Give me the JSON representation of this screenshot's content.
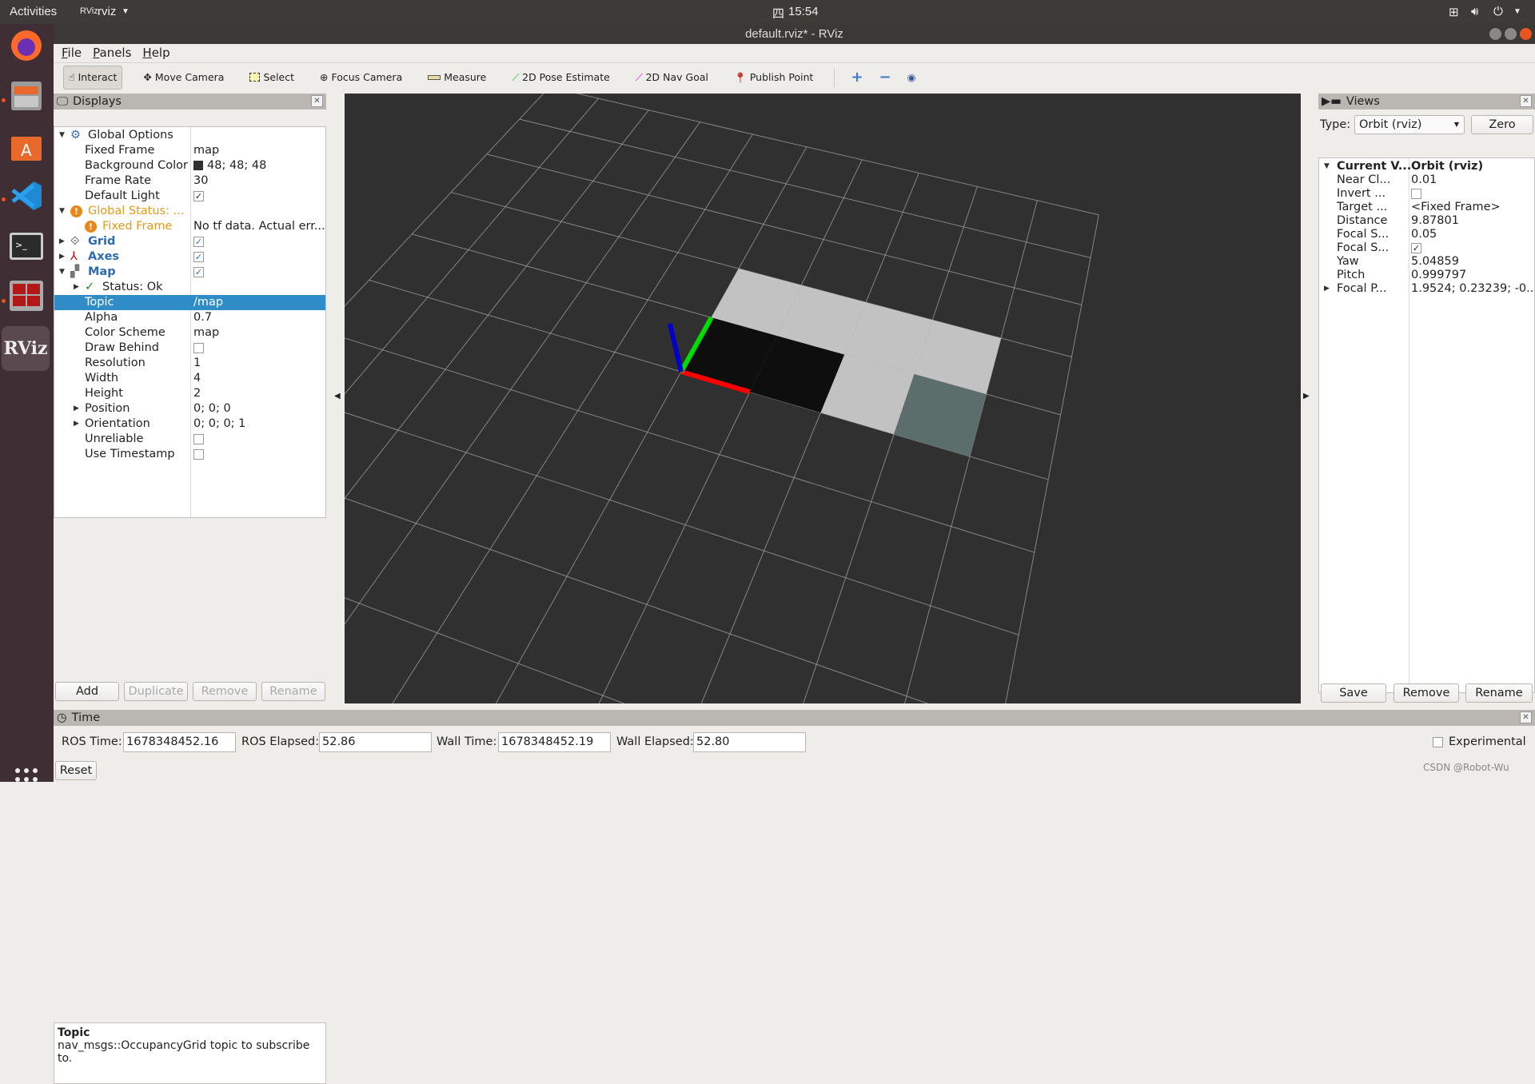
{
  "topbar": {
    "activities": "Activities",
    "app": "rviz",
    "clock": "15:54",
    "clock_glyph": "四"
  },
  "window": {
    "title": "default.rviz* - RViz"
  },
  "menu": [
    "File",
    "Panels",
    "Help"
  ],
  "toolbar": [
    {
      "label": "Interact",
      "icon": "hand-icon",
      "active": true
    },
    {
      "label": "Move Camera",
      "icon": "move-camera-icon"
    },
    {
      "label": "Select",
      "icon": "select-icon"
    },
    {
      "label": "Focus Camera",
      "icon": "focus-camera-icon"
    },
    {
      "label": "Measure",
      "icon": "ruler-icon"
    },
    {
      "label": "2D Pose Estimate",
      "icon": "green-arrow-icon"
    },
    {
      "label": "2D Nav Goal",
      "icon": "magenta-arrow-icon"
    },
    {
      "label": "Publish Point",
      "icon": "map-pin-icon"
    }
  ],
  "displays": {
    "title": "Displays",
    "rows": [
      {
        "k": "Global Options",
        "v": "",
        "indent": 0,
        "expand": "open",
        "icon": "gear"
      },
      {
        "k": "Fixed Frame",
        "v": "map",
        "indent": 1
      },
      {
        "k": "Background Color",
        "v": "48; 48; 48",
        "indent": 1,
        "swatch": "#303030"
      },
      {
        "k": "Frame Rate",
        "v": "30",
        "indent": 1
      },
      {
        "k": "Default Light",
        "v": "",
        "indent": 1,
        "check": "✓"
      },
      {
        "k": "Global Status: ...",
        "v": "",
        "indent": 0,
        "expand": "open",
        "icon": "warn",
        "cls": "orange"
      },
      {
        "k": "Fixed Frame",
        "v": "No tf data.  Actual err...",
        "indent": 1,
        "icon": "warn",
        "cls": "orange"
      },
      {
        "k": "Grid",
        "v": "",
        "indent": 0,
        "expand": "closed",
        "icon": "grid",
        "cls": "blue",
        "check": "✓"
      },
      {
        "k": "Axes",
        "v": "",
        "indent": 0,
        "expand": "closed",
        "icon": "axes",
        "cls": "blue",
        "check": "✓"
      },
      {
        "k": "Map",
        "v": "",
        "indent": 0,
        "expand": "open",
        "icon": "map",
        "cls": "blue",
        "check": "✓"
      },
      {
        "k": "Status: Ok",
        "v": "",
        "indent": 1,
        "expand": "closed",
        "icon": "ok"
      },
      {
        "k": "Topic",
        "v": "/map",
        "indent": 1,
        "selected": true
      },
      {
        "k": "Alpha",
        "v": "0.7",
        "indent": 1
      },
      {
        "k": "Color Scheme",
        "v": "map",
        "indent": 1
      },
      {
        "k": "Draw Behind",
        "v": "",
        "indent": 1,
        "check": ""
      },
      {
        "k": "Resolution",
        "v": "1",
        "indent": 1
      },
      {
        "k": "Width",
        "v": "4",
        "indent": 1
      },
      {
        "k": "Height",
        "v": "2",
        "indent": 1
      },
      {
        "k": "Position",
        "v": "0; 0; 0",
        "indent": 1,
        "expand": "closed"
      },
      {
        "k": "Orientation",
        "v": "0; 0; 0; 1",
        "indent": 1,
        "expand": "closed"
      },
      {
        "k": "Unreliable",
        "v": "",
        "indent": 1,
        "check": ""
      },
      {
        "k": "Use Timestamp",
        "v": "",
        "indent": 1,
        "check": ""
      }
    ],
    "desc_title": "Topic",
    "desc_text": "nav_msgs::OccupancyGrid topic to subscribe to.",
    "buttons": [
      "Add",
      "Duplicate",
      "Remove",
      "Rename"
    ]
  },
  "scene": {
    "background": "#303030",
    "grid_color": "#a0a0a0",
    "map_cells": [
      [
        "#0e0e0e",
        "#0e0e0e",
        "#c2c2c2",
        "#5b6e6b"
      ],
      [
        "#c2c2c2",
        "#c2c2c2",
        "#c2c2c2",
        "#c2c2c2"
      ]
    ],
    "axis_colors": {
      "x": "#ff0000",
      "y": "#00dd00",
      "z": "#0000cc"
    }
  },
  "views": {
    "title": "Views",
    "type_label": "Type:",
    "type_value": "Orbit (rviz)",
    "zero": "Zero",
    "rows": [
      {
        "k": "Current V...",
        "v": "Orbit (rviz)",
        "bold": true,
        "expand": "open"
      },
      {
        "k": "Near Cl...",
        "v": "0.01"
      },
      {
        "k": "Invert ...",
        "v": "",
        "check": ""
      },
      {
        "k": "Target ...",
        "v": "<Fixed Frame>"
      },
      {
        "k": "Distance",
        "v": "9.87801"
      },
      {
        "k": "Focal S...",
        "v": "0.05"
      },
      {
        "k": "Focal S...",
        "v": "",
        "check": "✓"
      },
      {
        "k": "Yaw",
        "v": "5.04859"
      },
      {
        "k": "Pitch",
        "v": "0.999797"
      },
      {
        "k": "Focal P...",
        "v": "1.9524; 0.23239; -0....",
        "expand": "closed"
      }
    ],
    "buttons": [
      "Save",
      "Remove",
      "Rename"
    ]
  },
  "time": {
    "title": "Time",
    "ros_time_label": "ROS Time:",
    "ros_time": "1678348452.16",
    "ros_elapsed_label": "ROS Elapsed:",
    "ros_elapsed": "52.86",
    "wall_time_label": "Wall Time:",
    "wall_time": "1678348452.19",
    "wall_elapsed_label": "Wall Elapsed:",
    "wall_elapsed": "52.80",
    "experimental": "Experimental",
    "reset": "Reset"
  },
  "watermark": "CSDN @Robot-Wu"
}
